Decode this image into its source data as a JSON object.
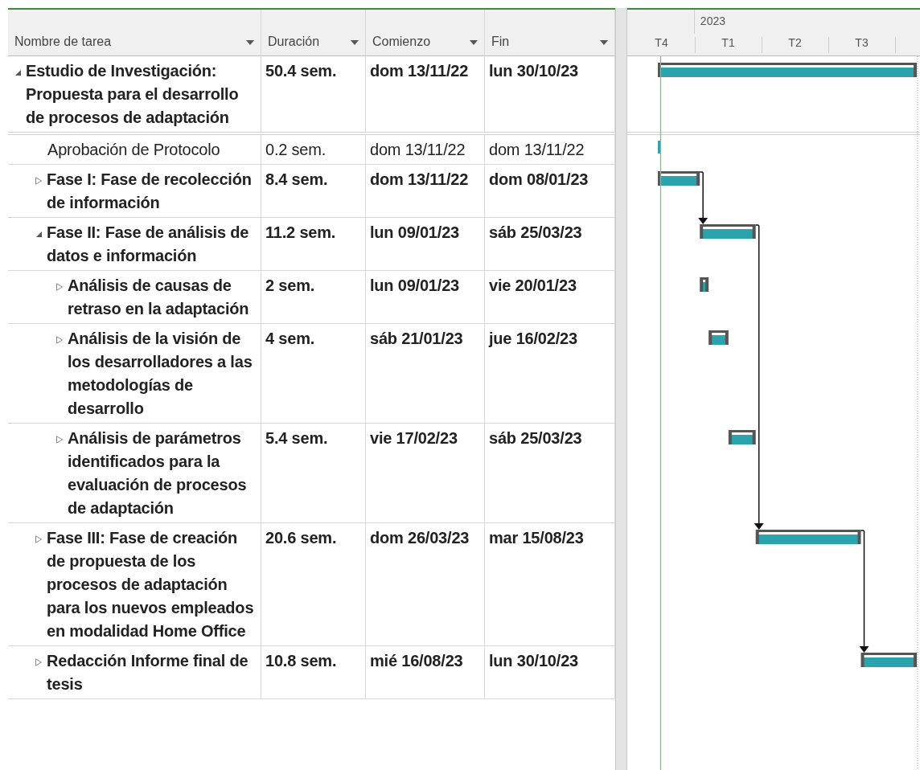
{
  "columns": [
    {
      "label": "Nombre de tarea"
    },
    {
      "label": "Duración"
    },
    {
      "label": "Comienzo"
    },
    {
      "label": "Fin"
    }
  ],
  "timescale": {
    "year": "2023",
    "quarters": [
      "T4",
      "T1",
      "T2",
      "T3"
    ]
  },
  "tasks": [
    {
      "kind": "summary",
      "name": "Estudio de Investigación: Propuesta para el desarrollo de procesos de adaptación",
      "duration": "50.4 sem.",
      "start": "dom 13/11/22",
      "finish": "lun 30/10/23",
      "expanded": true,
      "link_to_next": false,
      "children": [
        {
          "kind": "task",
          "name": "Aprobación de Protocolo",
          "duration": "0.2 sem.",
          "start": "dom 13/11/22",
          "finish": "dom 13/11/22",
          "link_to_next": false
        },
        {
          "kind": "summary",
          "name": "Fase I: Fase de recolección de información",
          "duration": "8.4 sem.",
          "start": "dom 13/11/22",
          "finish": "dom 08/01/23",
          "expanded": false,
          "link_to_next": true
        },
        {
          "kind": "summary",
          "name": "Fase II: Fase de análisis de datos e información",
          "duration": "11.2 sem.",
          "start": "lun 09/01/23",
          "finish": "sáb 25/03/23",
          "expanded": true,
          "link_to_next": true,
          "children": [
            {
              "kind": "summary",
              "name": "Análisis de causas de retraso en la adaptación",
              "duration": "2 sem.",
              "start": "lun 09/01/23",
              "finish": "vie 20/01/23",
              "expanded": false,
              "link_to_next": false
            },
            {
              "kind": "summary",
              "name": "Análisis de la visión de los desarrolladores a las metodologías de desarrollo",
              "duration": "4 sem.",
              "start": "sáb 21/01/23",
              "finish": "jue 16/02/23",
              "expanded": false,
              "link_to_next": false
            },
            {
              "kind": "summary",
              "name": "Análisis de parámetros identificados para la evaluación de procesos de adaptación",
              "duration": "5.4 sem.",
              "start": "vie 17/02/23",
              "finish": "sáb 25/03/23",
              "expanded": false,
              "link_to_next": false
            }
          ]
        },
        {
          "kind": "summary",
          "name": "Fase III: Fase de creación de propuesta de los procesos de adaptación para los nuevos empleados en modalidad Home Office",
          "duration": "20.6 sem.",
          "start": "dom 26/03/23",
          "finish": "mar 15/08/23",
          "expanded": false,
          "link_to_next": true
        },
        {
          "kind": "summary",
          "name": "Redacción Informe final de tesis",
          "duration": "10.8 sem.",
          "start": "mié 16/08/23",
          "finish": "lun 30/10/23",
          "expanded": false,
          "link_to_next": false
        }
      ]
    }
  ]
}
